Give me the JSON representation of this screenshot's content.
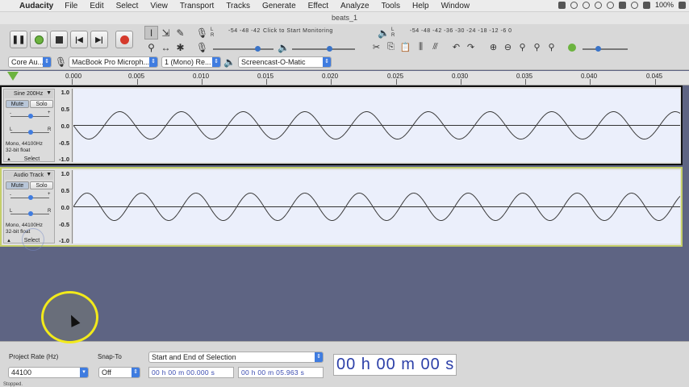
{
  "menubar": {
    "apple": "",
    "app": "Audacity",
    "items": [
      "File",
      "Edit",
      "Select",
      "View",
      "Transport",
      "Tracks",
      "Generate",
      "Effect",
      "Analyze",
      "Tools",
      "Help",
      "Window"
    ],
    "battery": "100%"
  },
  "window": {
    "title": "beats_1"
  },
  "toolbar": {
    "pause_icon": "pause-icon",
    "play_icon": "play-icon",
    "stop_icon": "stop-icon",
    "skip_start_icon": "skip-start-icon",
    "skip_end_icon": "skip-end-icon",
    "record_icon": "record-icon",
    "rec_meter_scale": "-54  -48  -42  -36  -30  -24  -18  -12  -6  0",
    "monitor_label": "Click to Start Monitoring",
    "monitor_scale": "-54  -48  -42  -36  -30  -24  -18  -12  -6  0",
    "play_meter_scale": "-54  -48  -42  -36  -30  -24  -18  -12  -6  0",
    "accent": "#3f7ce0"
  },
  "device": {
    "host": "Core Au...",
    "mic": "MacBook Pro Microph...",
    "channels": "1 (Mono) Re...",
    "output": "Screencast-O-Matic"
  },
  "ruler": {
    "labels": [
      "0.000",
      "0.005",
      "0.010",
      "0.015",
      "0.020",
      "0.025",
      "0.030",
      "0.035",
      "0.040",
      "0.045"
    ]
  },
  "tracks": [
    {
      "name": "Sine 200Hz",
      "mute": "Mute",
      "solo": "Solo",
      "info1": "Mono, 44100Hz",
      "info2": "32-bit float",
      "select": "Select",
      "scale": [
        "1.0",
        "0.5",
        "0.0",
        "-0.5",
        "-1.0"
      ]
    },
    {
      "name": "Audio Track",
      "mute": "Mute",
      "solo": "Solo",
      "info1": "Mono, 44100Hz",
      "info2": "32-bit float",
      "select": "Select",
      "scale": [
        "1.0",
        "0.5",
        "0.0",
        "-0.5",
        "-1.0"
      ]
    }
  ],
  "bottom": {
    "rate_label": "Project Rate (Hz)",
    "rate_value": "44100",
    "snap_label": "Snap-To",
    "snap_value": "Off",
    "selection_mode": "Start and End of Selection",
    "sel_start": "00 h 00 m 00.000 s",
    "sel_end": "00 h 00 m 05.963 s",
    "audio_pos": "00 h 00 m 00 s"
  },
  "status": "Stopped."
}
